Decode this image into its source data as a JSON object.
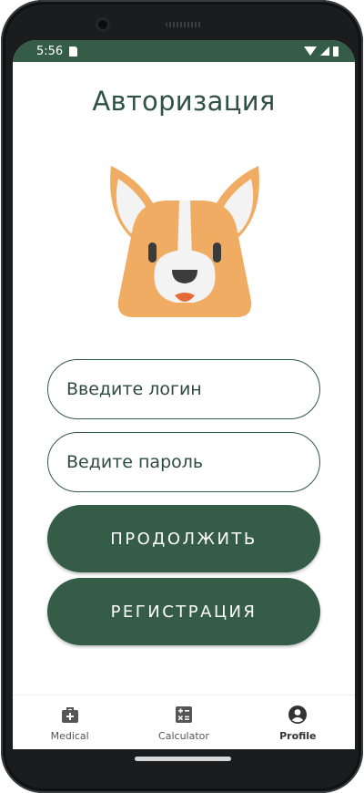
{
  "status_bar": {
    "time": "5:56"
  },
  "auth": {
    "title": "Авторизация",
    "login_placeholder": "Введите логин",
    "password_placeholder": "Ведите пароль",
    "continue_label": "ПРОДОЛЖИТЬ",
    "register_label": "РЕГИСТРАЦИЯ"
  },
  "nav": {
    "items": [
      {
        "label": "Medical",
        "icon": "medical-kit-icon",
        "active": false
      },
      {
        "label": "Calculator",
        "icon": "calculator-icon",
        "active": false
      },
      {
        "label": "Profile",
        "icon": "profile-icon",
        "active": true
      }
    ]
  },
  "colors": {
    "primary": "#355c46",
    "mascot_orange": "#f0ac63",
    "mascot_ear_inner": "#f3f3f3",
    "mascot_tongue": "#e46a3a"
  }
}
